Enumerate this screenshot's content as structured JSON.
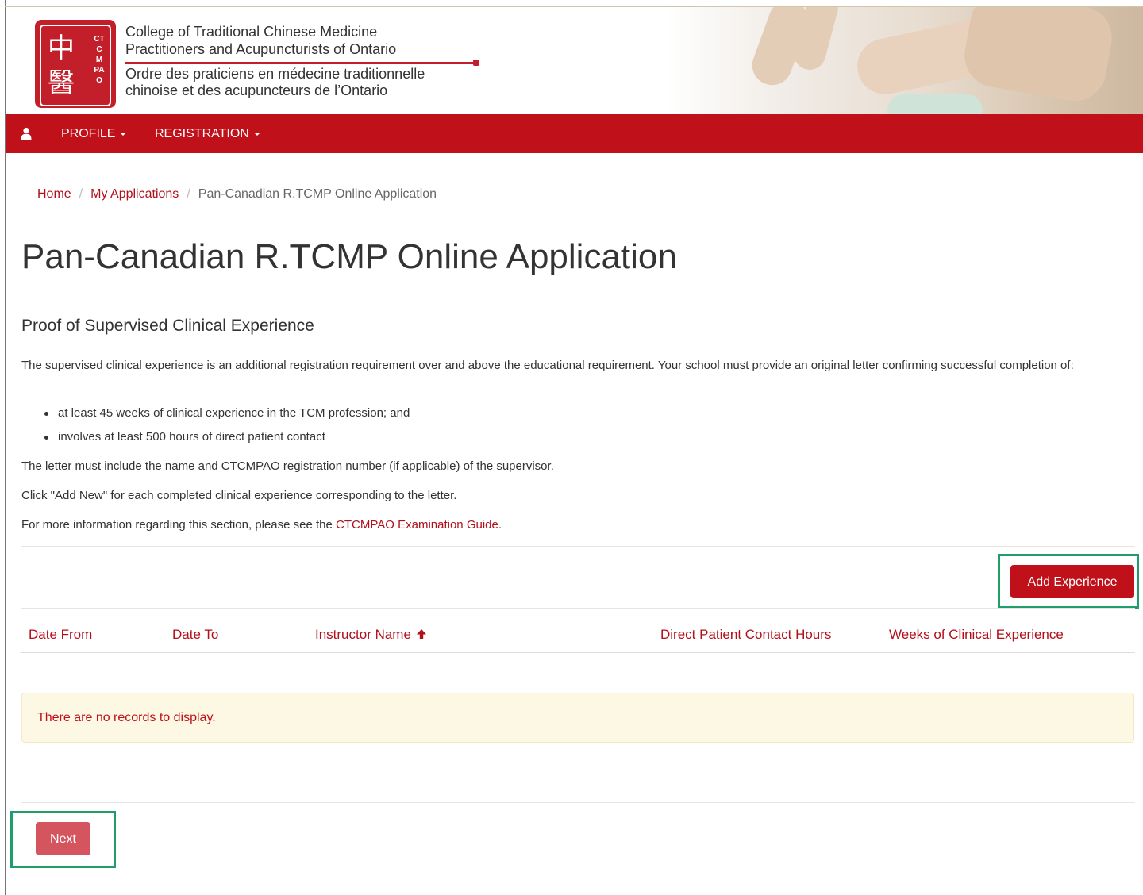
{
  "header": {
    "logo": {
      "side_text": "CTCMPAO"
    },
    "org_name_en_line1": "College of Traditional Chinese Medicine",
    "org_name_en_line2": "Practitioners and Acupuncturists of Ontario",
    "org_name_fr_line1": "Ordre des praticiens en médecine traditionnelle",
    "org_name_fr_line2": "chinoise et des acupuncteurs de l’Ontario"
  },
  "nav": {
    "user_icon": "user-icon",
    "items": [
      {
        "label": "PROFILE"
      },
      {
        "label": "REGISTRATION"
      }
    ]
  },
  "breadcrumb": {
    "items": [
      {
        "label": "Home"
      },
      {
        "label": "My Applications"
      },
      {
        "label": "Pan-Canadian R.TCMP Online Application"
      }
    ]
  },
  "page": {
    "title": "Pan-Canadian R.TCMP Online Application",
    "section_title": "Proof of Supervised Clinical Experience",
    "intro": "The supervised clinical experience is an additional registration requirement over and above the educational requirement. Your school must provide an original letter confirming successful completion of:",
    "bullets": [
      "at least 45 weeks of clinical experience in the TCM profession; and",
      "involves at least 500 hours of direct patient contact"
    ],
    "letter_note": "The letter must include the name and CTCMPAO registration number (if applicable) of the supervisor.",
    "add_new_note": "Click \"Add New\" for each completed clinical experience corresponding to the letter.",
    "more_info_prefix": "For more information regarding this section, please see the ",
    "more_info_link": "CTCMPAO Examination Guide",
    "more_info_suffix": "."
  },
  "actions": {
    "add_experience_label": "Add Experience",
    "next_label": "Next"
  },
  "table": {
    "columns": [
      {
        "label": "Date From"
      },
      {
        "label": "Date To"
      },
      {
        "label": "Instructor Name",
        "sorted": "ascending"
      },
      {
        "label": "Direct Patient Contact Hours"
      },
      {
        "label": "Weeks of Clinical Experience"
      }
    ],
    "rows": [],
    "empty_message": "There are no records to display."
  },
  "colors": {
    "brand_red": "#c0101a",
    "link_red": "#b20f1a",
    "highlight_green": "#1f9d6b",
    "alert_bg": "#fcf8e3"
  }
}
